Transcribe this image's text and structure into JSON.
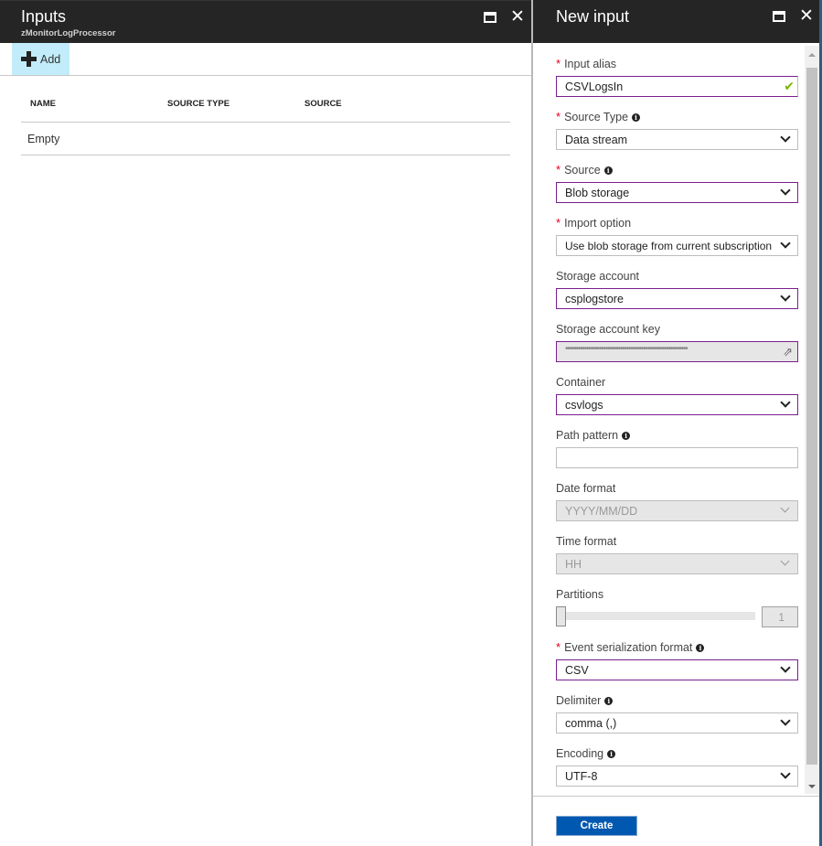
{
  "left_blade": {
    "title": "Inputs",
    "subtitle": "zMonitorLogProcessor",
    "toolbar": {
      "add_label": "Add"
    },
    "table": {
      "columns": [
        "NAME",
        "SOURCE TYPE",
        "SOURCE"
      ],
      "empty_text": "Empty"
    }
  },
  "right_blade": {
    "title": "New input",
    "fields": {
      "input_alias": {
        "label": "Input alias",
        "required": true,
        "value": "CSVLogsIn",
        "valid": true
      },
      "source_type": {
        "label": "Source Type",
        "required": true,
        "value": "Data stream"
      },
      "source": {
        "label": "Source",
        "required": true,
        "value": "Blob storage"
      },
      "import_option": {
        "label": "Import option",
        "required": true,
        "value": "Use blob storage from current subscription"
      },
      "storage_account": {
        "label": "Storage account",
        "value": "csplogstore"
      },
      "storage_account_key": {
        "label": "Storage account key",
        "value": "••••••••••••••••••••••••••••••••••••••••••••••••••••••••••"
      },
      "container": {
        "label": "Container",
        "value": "csvlogs"
      },
      "path_pattern": {
        "label": "Path pattern",
        "value": ""
      },
      "date_format": {
        "label": "Date format",
        "value": "YYYY/MM/DD",
        "disabled": true
      },
      "time_format": {
        "label": "Time format",
        "value": "HH",
        "disabled": true
      },
      "partitions": {
        "label": "Partitions",
        "value": "1",
        "slider_fraction": 0
      },
      "event_serialization_format": {
        "label": "Event serialization format",
        "required": true,
        "value": "CSV"
      },
      "delimiter": {
        "label": "Delimiter",
        "value": "comma (,)"
      },
      "encoding": {
        "label": "Encoding",
        "value": "UTF-8"
      }
    },
    "required_marker": "*",
    "info_glyph": "i",
    "check_glyph": "✔",
    "key_glyph": "⇗",
    "close_glyph": "✕",
    "create_label": "Create"
  },
  "colors": {
    "header_bg": "#252525",
    "add_button_bg": "#c2ecf9",
    "selected_border": "#7a1f8e",
    "required": "#e3001b",
    "valid_check": "#7ab800",
    "primary_button": "#0058b0"
  }
}
